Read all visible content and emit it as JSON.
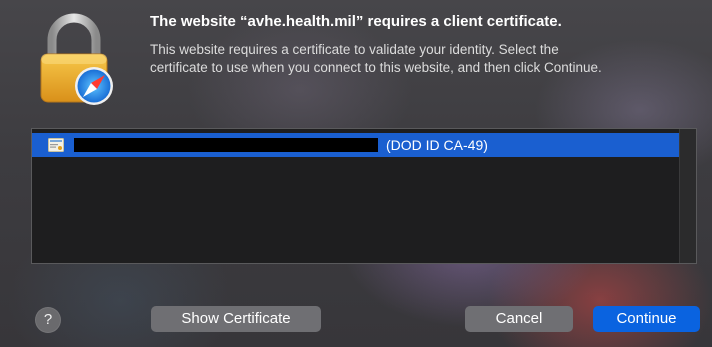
{
  "dialog": {
    "title": "The website “avhe.health.mil” requires a client certificate.",
    "description_lines": [
      "This website requires a certificate to validate your identity. Select the",
      "certificate to use when you connect to this website, and then click Continue."
    ]
  },
  "certificates": [
    {
      "name_suffix": "(DOD ID CA-49)",
      "selected": true
    }
  ],
  "buttons": {
    "help": "?",
    "show_certificate": "Show Certificate",
    "cancel": "Cancel",
    "continue": "Continue"
  },
  "icons": {
    "app": "lock-safari-icon",
    "certificate": "certificate-icon"
  },
  "colors": {
    "selection": "#1a5fd0",
    "default_button": "#0a63e0",
    "secondary_button": "#6f6f73"
  }
}
